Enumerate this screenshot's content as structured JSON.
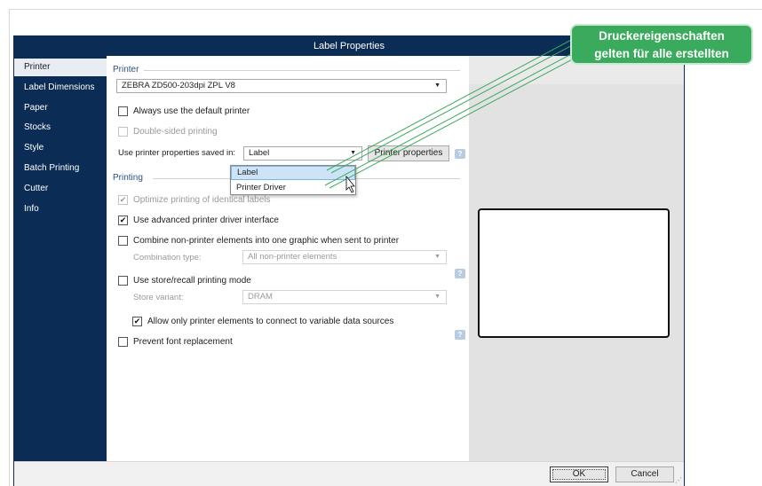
{
  "dialog": {
    "title": "Label Properties"
  },
  "sidebar": {
    "items": [
      {
        "label": "Printer",
        "active": true
      },
      {
        "label": "Label Dimensions"
      },
      {
        "label": "Paper"
      },
      {
        "label": "Stocks"
      },
      {
        "label": "Style"
      },
      {
        "label": "Batch Printing"
      },
      {
        "label": "Cutter"
      },
      {
        "label": "Info"
      }
    ]
  },
  "printer_section": {
    "heading": "Printer",
    "printer_select": "ZEBRA ZD500-203dpi ZPL V8",
    "always_default": {
      "label": "Always use the default printer",
      "checked": false
    },
    "double_sided": {
      "label": "Double-sided printing",
      "checked": false,
      "disabled": true
    },
    "props_saved_label": "Use printer properties saved in:",
    "props_saved_value": "Label",
    "printer_properties_button": "Printer properties",
    "dropdown_options": [
      "Label",
      "Printer Driver"
    ],
    "dropdown_selected": "Label"
  },
  "printing_section": {
    "heading": "Printing",
    "optimize": {
      "label": "Optimize printing of identical labels",
      "checked": true,
      "disabled": true
    },
    "advanced_driver": {
      "label": "Use advanced printer driver interface",
      "checked": true
    },
    "combine": {
      "label": "Combine non-printer elements into one graphic when sent to printer",
      "checked": false
    },
    "combination_type_label": "Combination type:",
    "combination_type_value": "All non-printer elements",
    "store_recall": {
      "label": "Use store/recall printing mode",
      "checked": false
    },
    "store_variant_label": "Store variant:",
    "store_variant_value": "DRAM",
    "allow_only": {
      "label": "Allow only printer elements to connect to variable data sources",
      "checked": true
    },
    "prevent_font": {
      "label": "Prevent font replacement",
      "checked": false
    }
  },
  "footer": {
    "ok_label": "OK",
    "cancel_label": "Cancel"
  },
  "callout": {
    "line1": "Druckereigenschaften",
    "line2": "gelten für alle erstellten"
  },
  "icons": {
    "help": "help-icon",
    "check": "✔",
    "dropdown_arrow": "▼",
    "cursor": "mouse-pointer-icon",
    "resize_grip": "resize-grip-icon"
  },
  "colors": {
    "navy": "#0b2d55",
    "callout_green": "#3aaa5c",
    "section_heading": "#2b4f7e",
    "dropdown_selected": "#cde4f7"
  }
}
